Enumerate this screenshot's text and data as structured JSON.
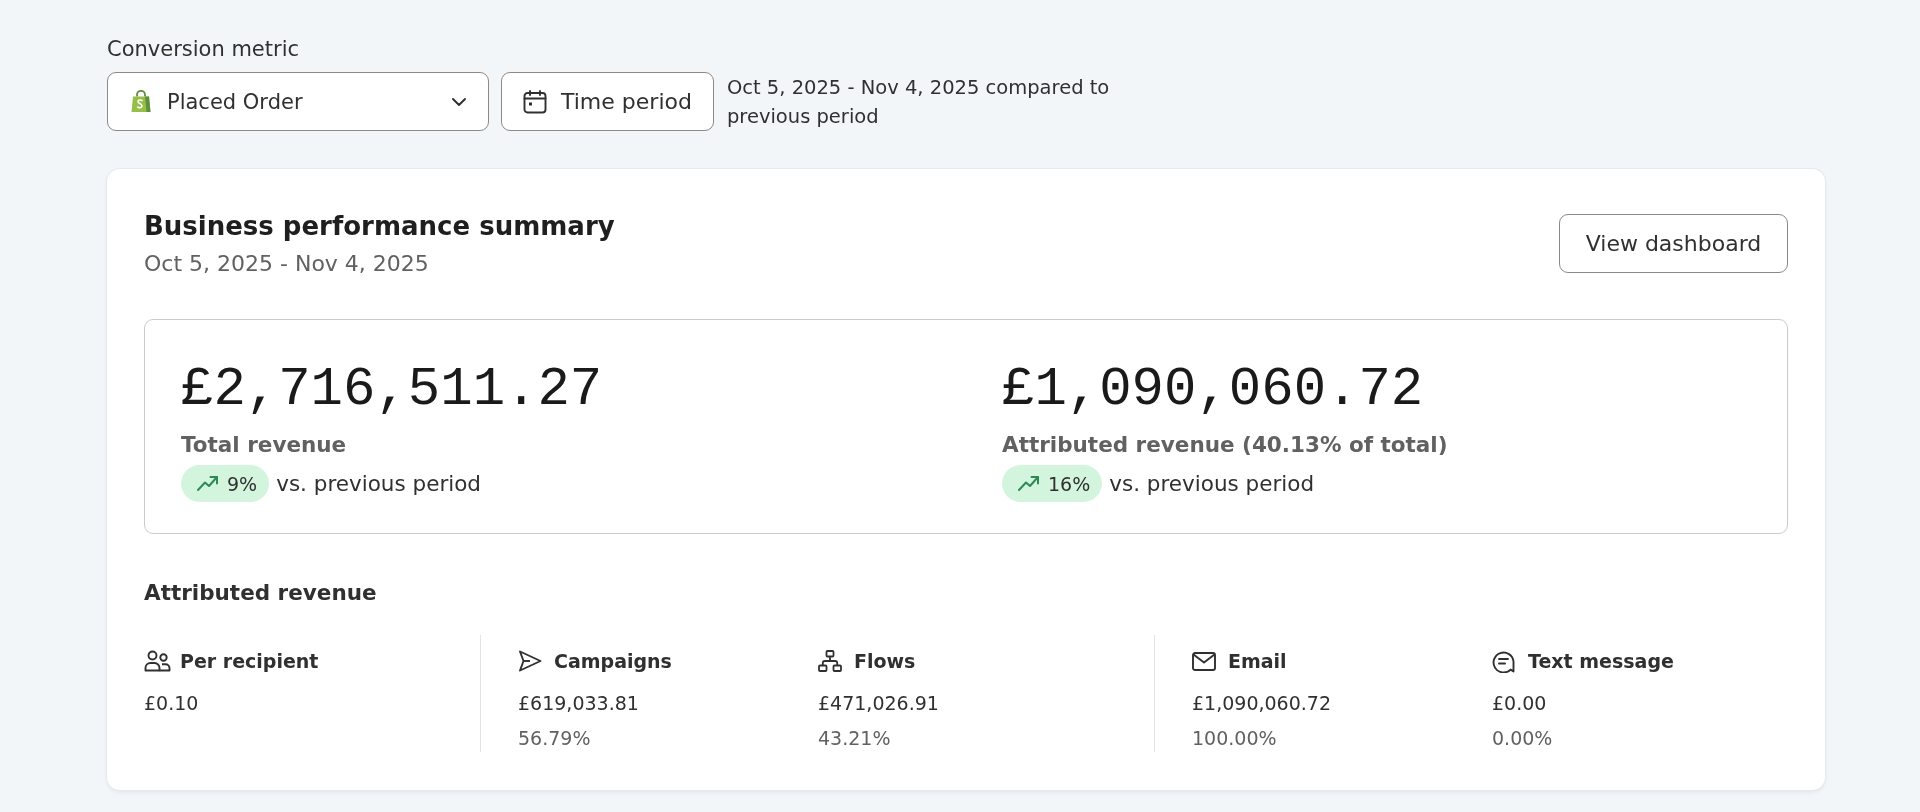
{
  "conversion_metric": {
    "label": "Conversion metric",
    "dropdown": {
      "value": "Placed Order"
    },
    "time_period_button": "Time period",
    "date_range_note": "Oct 5, 2025 - Nov 4, 2025 compared to previous period"
  },
  "summary_card": {
    "title": "Business performance summary",
    "date_range": "Oct 5, 2025 - Nov 4, 2025",
    "view_button": "View dashboard",
    "metrics": [
      {
        "value": "£2,716,511.27",
        "label": "Total revenue",
        "change": "9%",
        "increase": true,
        "comparison": "vs. previous period"
      },
      {
        "value": "£1,090,060.72",
        "label": "Attributed revenue (40.13% of total)",
        "change": "16%",
        "increase": true,
        "comparison": "vs. previous period"
      }
    ],
    "attributed_revenue": {
      "title": "Attributed revenue",
      "groups": [
        {
          "items": [
            {
              "kind": "recipients",
              "label": "Per recipient",
              "value": "£0.10"
            }
          ]
        },
        {
          "items": [
            {
              "kind": "campaigns",
              "label": "Campaigns",
              "value": "£619,033.81",
              "share": "56.79%"
            },
            {
              "kind": "flows",
              "label": "Flows",
              "value": "£471,026.91",
              "share": "43.21%"
            }
          ]
        },
        {
          "items": [
            {
              "kind": "email",
              "label": "Email",
              "value": "£1,090,060.72",
              "share": "100.00%"
            },
            {
              "kind": "sms",
              "label": "Text message",
              "value": "£0.00",
              "share": "0.00%"
            }
          ]
        }
      ]
    }
  }
}
